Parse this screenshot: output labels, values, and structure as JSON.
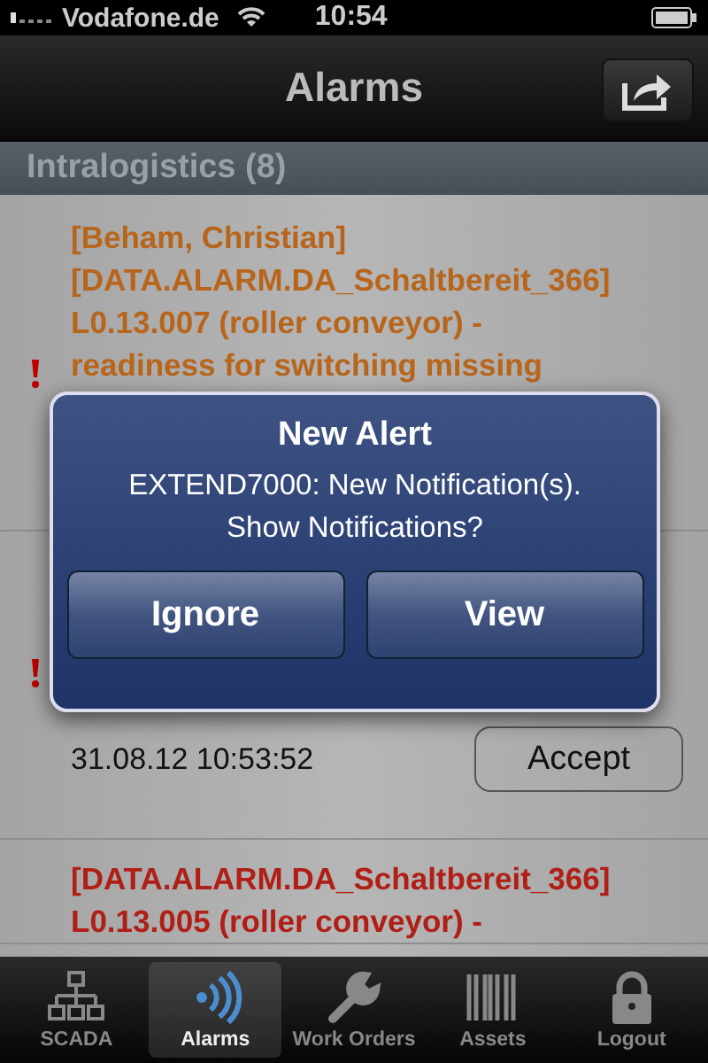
{
  "status_bar": {
    "carrier": "Vodafone.de",
    "time": "10:54"
  },
  "nav_bar": {
    "title": "Alarms"
  },
  "section": {
    "title": "Intralogistics (8)"
  },
  "alarms": [
    {
      "lines": [
        "[Beham, Christian]",
        "[DATA.ALARM.DA_Schaltbereit_366]",
        "L0.13.007 (roller conveyor) -",
        "readiness for switching missing"
      ],
      "color": "#b8651c",
      "flagged": true
    },
    {
      "flagged": true,
      "timestamp": "31.08.12 10:53:52",
      "action": "Accept"
    },
    {
      "lines": [
        "[DATA.ALARM.DA_Schaltbereit_366]",
        "L0.13.005 (roller conveyor) -"
      ],
      "color": "#b01e16"
    }
  ],
  "alert": {
    "title": "New Alert",
    "message": "EXTEND7000: New Notification(s).\nShow Notifications?",
    "buttons": [
      "Ignore",
      "View"
    ]
  },
  "tab_bar": [
    {
      "label": "SCADA",
      "kind": "network",
      "selected": false
    },
    {
      "label": "Alarms",
      "kind": "signal",
      "selected": true
    },
    {
      "label": "Work Orders",
      "kind": "wrench",
      "selected": false
    },
    {
      "label": "Assets",
      "kind": "barcode",
      "selected": false
    },
    {
      "label": "Logout",
      "kind": "lock",
      "selected": false
    }
  ]
}
